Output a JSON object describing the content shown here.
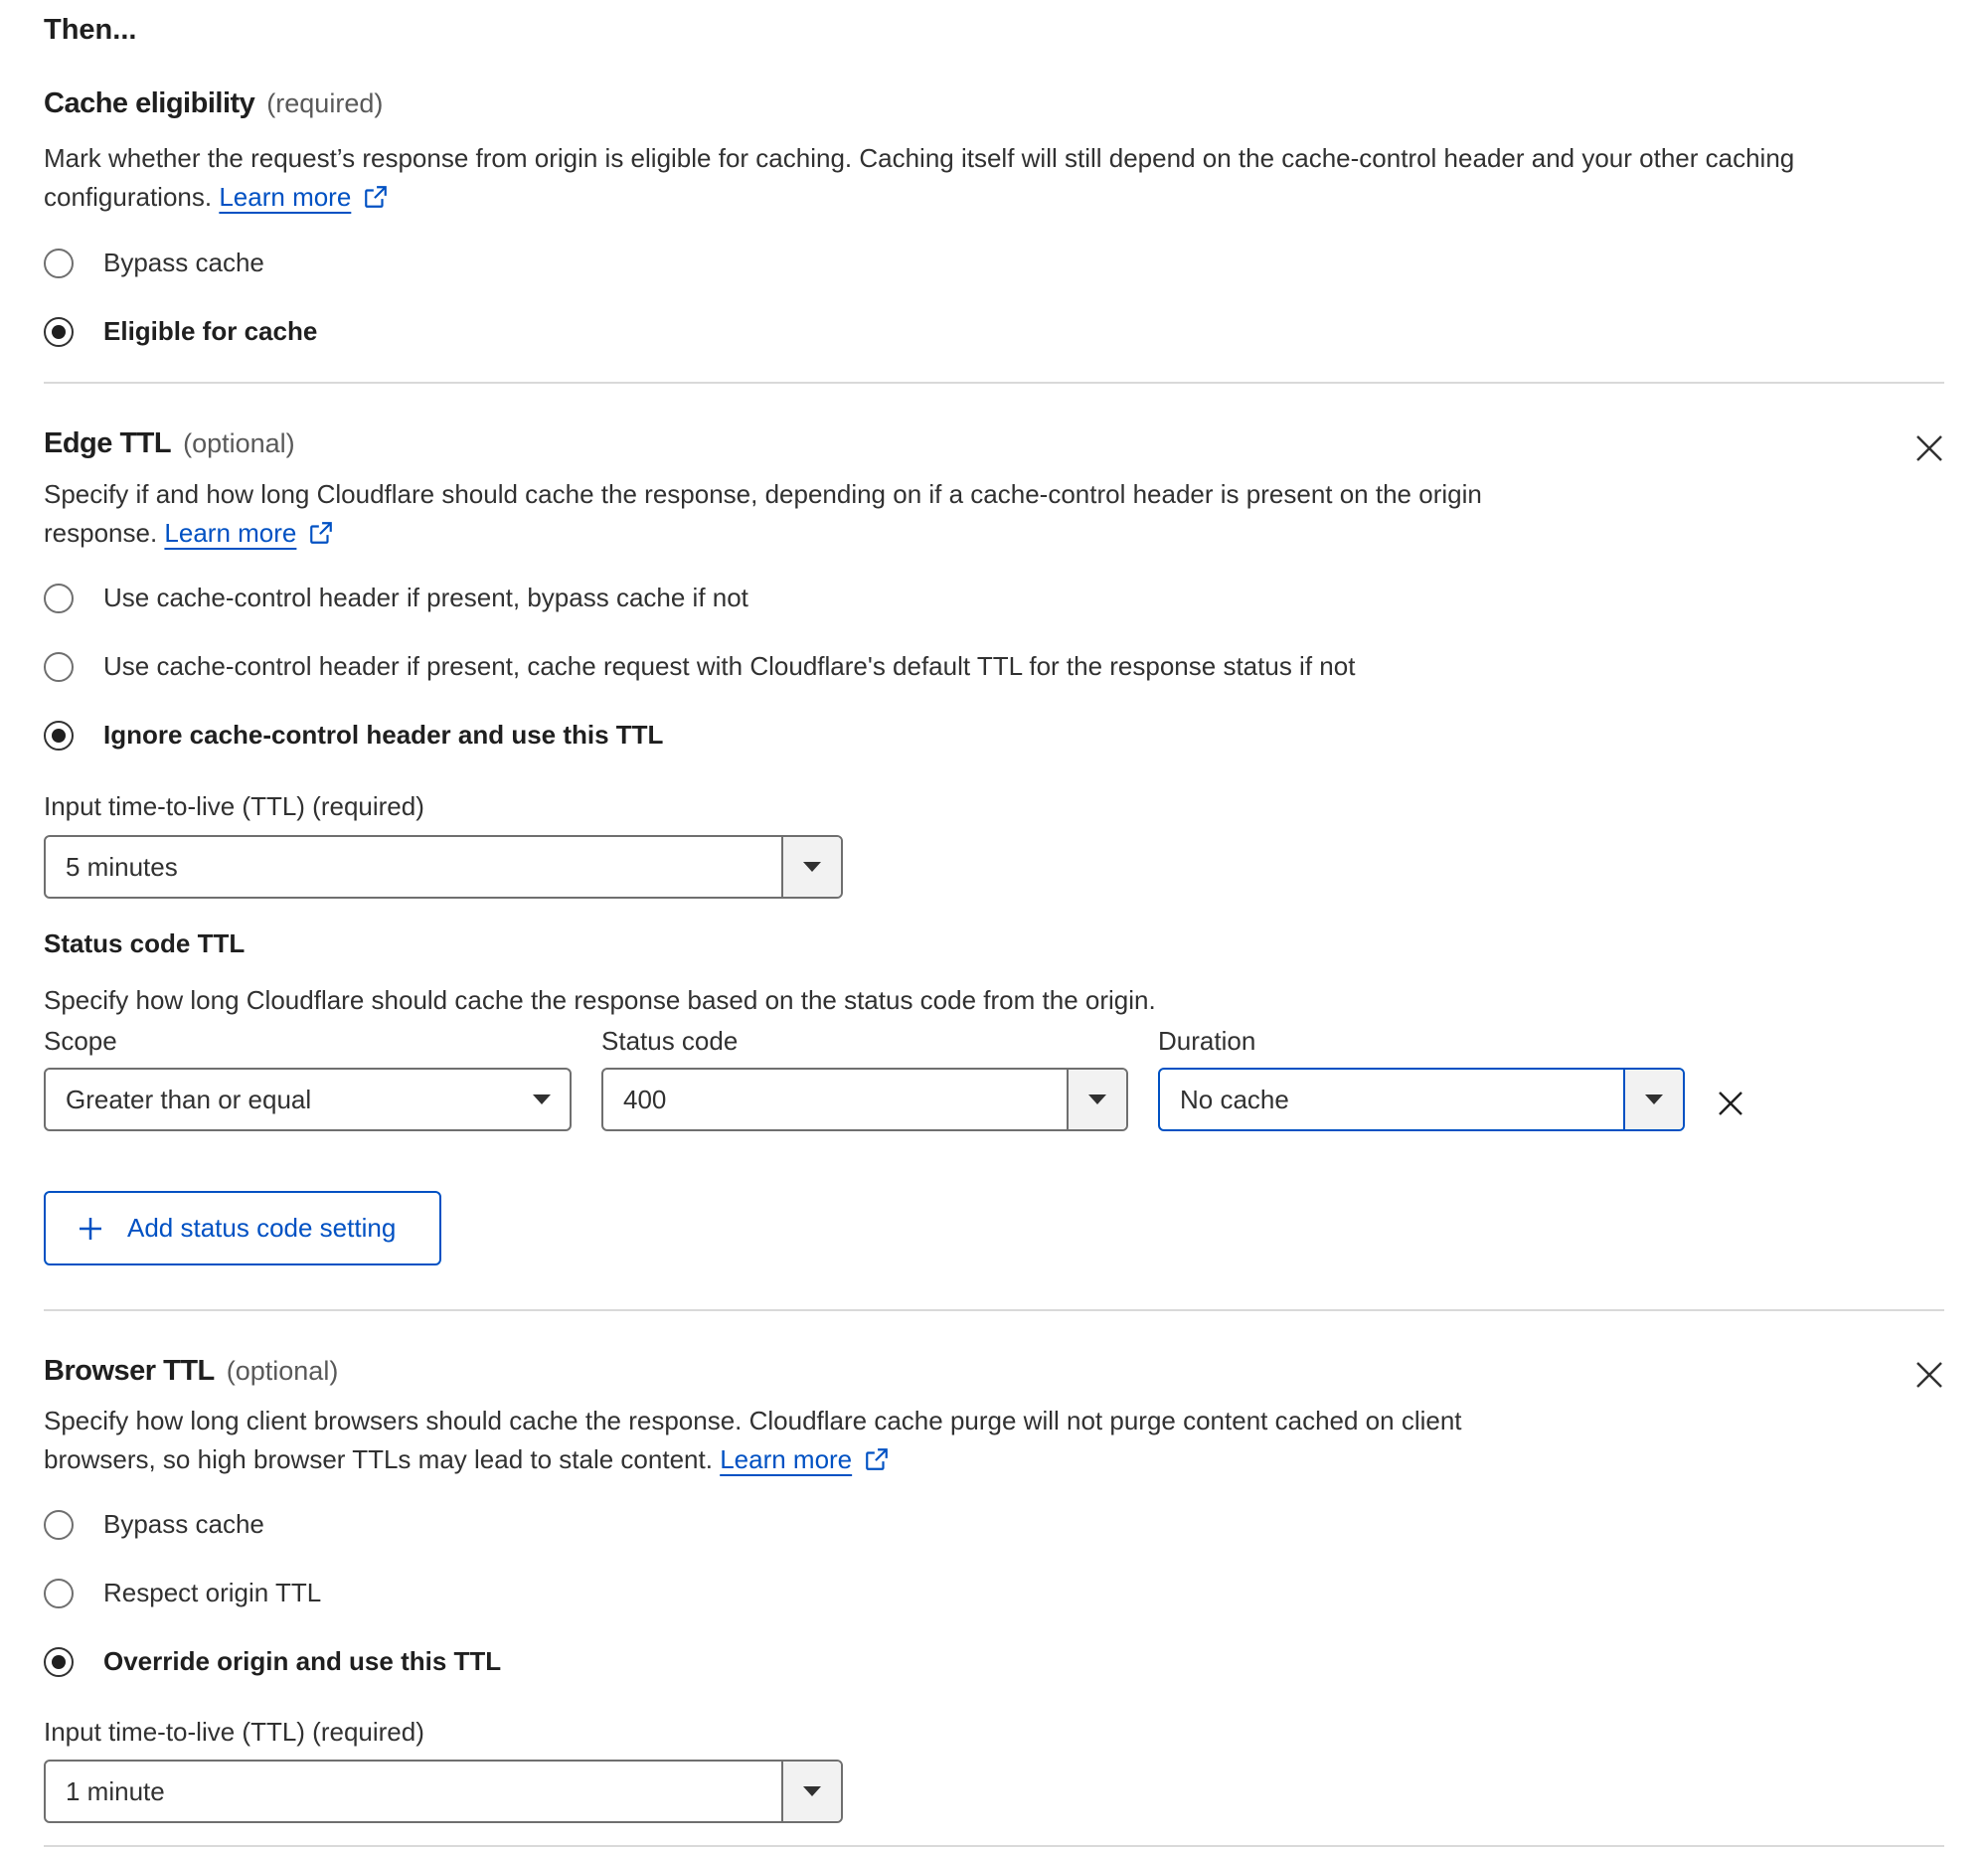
{
  "header": {
    "title": "Then..."
  },
  "cache_eligibility": {
    "title": "Cache eligibility",
    "note": "(required)",
    "desc_line1": "Mark whether the request’s response from origin is eligible for caching. Caching itself will still depend on the cache-control header and your other caching",
    "desc_line2": "configurations.",
    "learn_more": "Learn more",
    "options": [
      "Bypass cache",
      "Eligible for cache"
    ],
    "selected": "Eligible for cache"
  },
  "edge_ttl": {
    "title": "Edge TTL",
    "note": "(optional)",
    "desc_line1": "Specify if and how long Cloudflare should cache the response, depending on if a cache-control header is present on the origin",
    "desc_line2": "response.",
    "learn_more": "Learn more",
    "options": [
      "Use cache-control header if present, bypass cache if not",
      "Use cache-control header if present, cache request with Cloudflare's default TTL for the response status if not",
      "Ignore cache-control header and use this TTL"
    ],
    "selected": "Ignore cache-control header and use this TTL",
    "ttl_label": "Input time-to-live (TTL) (required)",
    "ttl_value": "5 minutes",
    "status_code_ttl": {
      "title": "Status code TTL",
      "desc": "Specify how long Cloudflare should cache the response based on the status code from the origin.",
      "scope_label": "Scope",
      "scope_value": "Greater than or equal",
      "status_label": "Status code",
      "status_value": "400",
      "duration_label": "Duration",
      "duration_value": "No cache",
      "add_button": "Add status code setting"
    }
  },
  "browser_ttl": {
    "title": "Browser TTL",
    "note": "(optional)",
    "desc_line1": "Specify how long client browsers should cache the response. Cloudflare cache purge will not purge content cached on client",
    "desc_line2": "browsers, so high browser TTLs may lead to stale content.",
    "learn_more": "Learn more",
    "options": [
      "Bypass cache",
      "Respect origin TTL",
      "Override origin and use this TTL"
    ],
    "selected": "Override origin and use this TTL",
    "ttl_label": "Input time-to-live (TTL) (required)",
    "ttl_value": "1 minute"
  },
  "colors": {
    "link": "#0051c3",
    "border": "#6f6f6f",
    "divider": "#d9d9d9",
    "text": "#313131"
  },
  "icons": [
    "external-link-icon",
    "close-icon",
    "chevron-down-icon",
    "plus-icon"
  ]
}
